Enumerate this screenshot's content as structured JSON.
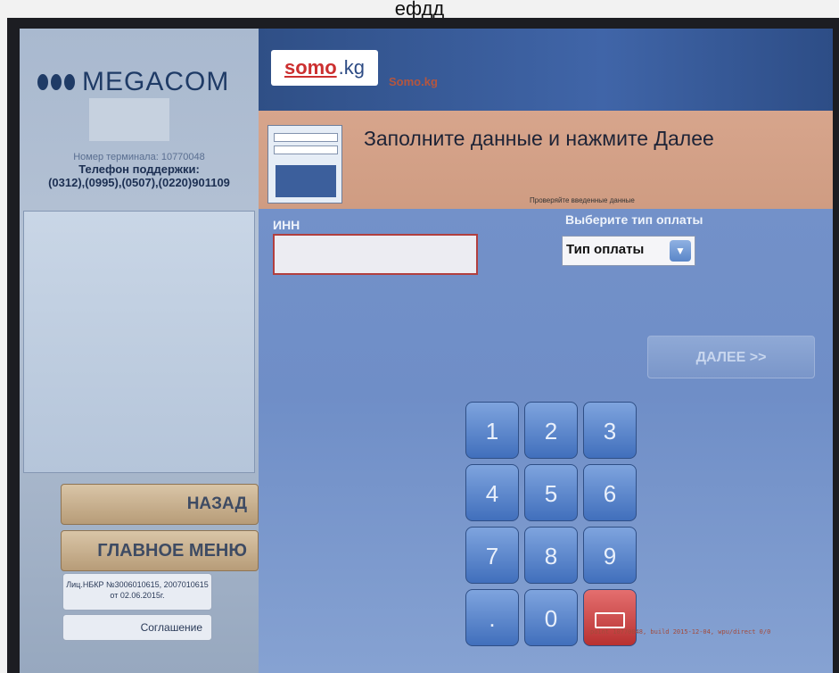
{
  "caption": "ефдд",
  "left_panel": {
    "brand": "MEGACOM",
    "terminal_number": "Номер терминала: 10770048",
    "support_label": "Телефон поддержки:",
    "support_phones": "(0312),(0995),(0507),(0220)901109",
    "back_button": "НАЗАД",
    "main_menu_button": "ГЛАВНОЕ МЕНЮ",
    "license_text": "Лиц.НБКР №3006010615, 2007010615 от 02.06.2015г.",
    "agreement_button": "Соглашение"
  },
  "header": {
    "logo_main": "somo",
    "logo_suffix": ".kg",
    "service_name": "Somo.kg"
  },
  "banner": {
    "title": "Заполните данные и нажмите Далее",
    "hint": "Проверяйте введенные данные",
    "icon_value": "43647"
  },
  "form": {
    "inn_label": "ИНН",
    "inn_value": "",
    "payment_type_label": "Выберите тип оплаты",
    "payment_type_selected": "Тип оплаты"
  },
  "next_button": "ДАЛЕЕ >>",
  "keypad": {
    "keys": [
      "1",
      "2",
      "3",
      "4",
      "5",
      "6",
      "7",
      "8",
      "9",
      ".",
      "0"
    ],
    "backspace_icon": "backspace-icon"
  },
  "build_info": "point 10770048, build 2015-12-04, wpu/direct 0/0",
  "colors": {
    "screen_blue": "#6f8ec7",
    "banner_salmon": "#d7a58c",
    "left_panel": "#b6c3d5",
    "back_key_red": "#c84444"
  }
}
